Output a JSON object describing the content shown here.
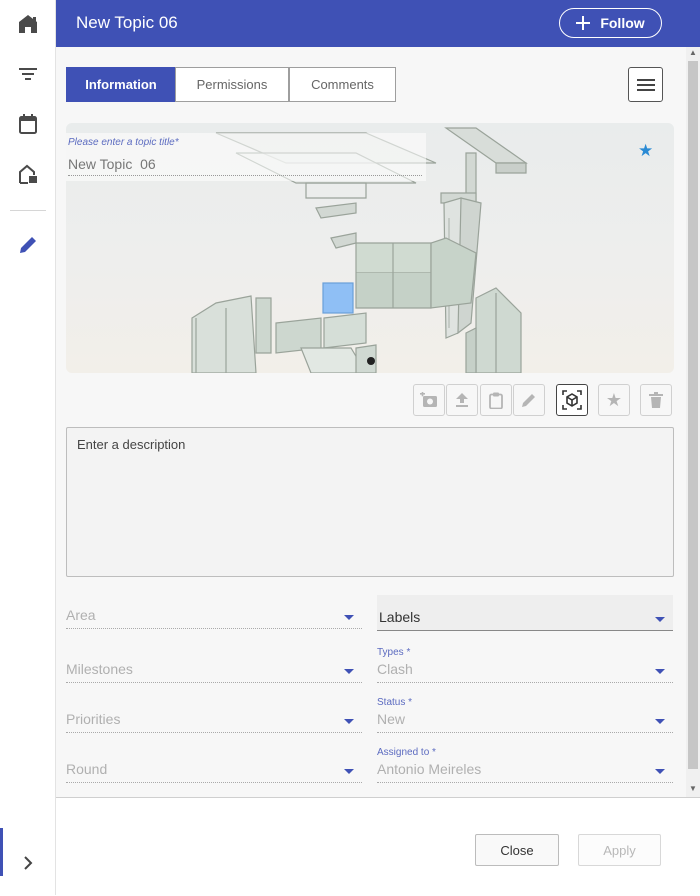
{
  "header": {
    "title": "New Topic 06",
    "follow_label": "Follow"
  },
  "rail": {
    "items": [
      {
        "icon": "home-icon"
      },
      {
        "icon": "filter-icon"
      },
      {
        "icon": "calendar-icon"
      },
      {
        "icon": "building-icon"
      },
      {
        "icon": "pencil-icon",
        "active": true
      },
      {
        "icon": "chevron-right-icon"
      }
    ]
  },
  "tabs": [
    {
      "label": "Information",
      "active": true
    },
    {
      "label": "Permissions"
    },
    {
      "label": "Comments"
    }
  ],
  "topic": {
    "title_label": "Please enter a topic title",
    "required_marker": "*",
    "title_value": "New Topic  06"
  },
  "toolbar": {
    "buttons": [
      {
        "icon": "camera-add-icon",
        "active": false
      },
      {
        "icon": "upload-icon",
        "active": false
      },
      {
        "icon": "clipboard-icon",
        "active": false
      },
      {
        "icon": "edit-icon",
        "active": false
      },
      {
        "icon": "3d-cube-icon",
        "active": true
      },
      {
        "icon": "star-icon",
        "active": false
      },
      {
        "icon": "trash-icon",
        "active": false
      }
    ]
  },
  "description": {
    "placeholder": "Enter a description"
  },
  "fields": {
    "area": {
      "placeholder": "Area"
    },
    "labels": {
      "value": "Labels"
    },
    "milestones": {
      "placeholder": "Milestones"
    },
    "types": {
      "label": "Types *",
      "value": "Clash"
    },
    "priorities": {
      "placeholder": "Priorities"
    },
    "status": {
      "label": "Status *",
      "value": "New"
    },
    "round": {
      "placeholder": "Round"
    },
    "assigned_to": {
      "label": "Assigned to *",
      "value": "Antonio  Meireles"
    }
  },
  "footer": {
    "close_label": "Close",
    "apply_label": "Apply"
  },
  "colors": {
    "primary": "#3f51b5",
    "star": "#2a8ad4",
    "highlight_panel": "#8fbff5"
  }
}
